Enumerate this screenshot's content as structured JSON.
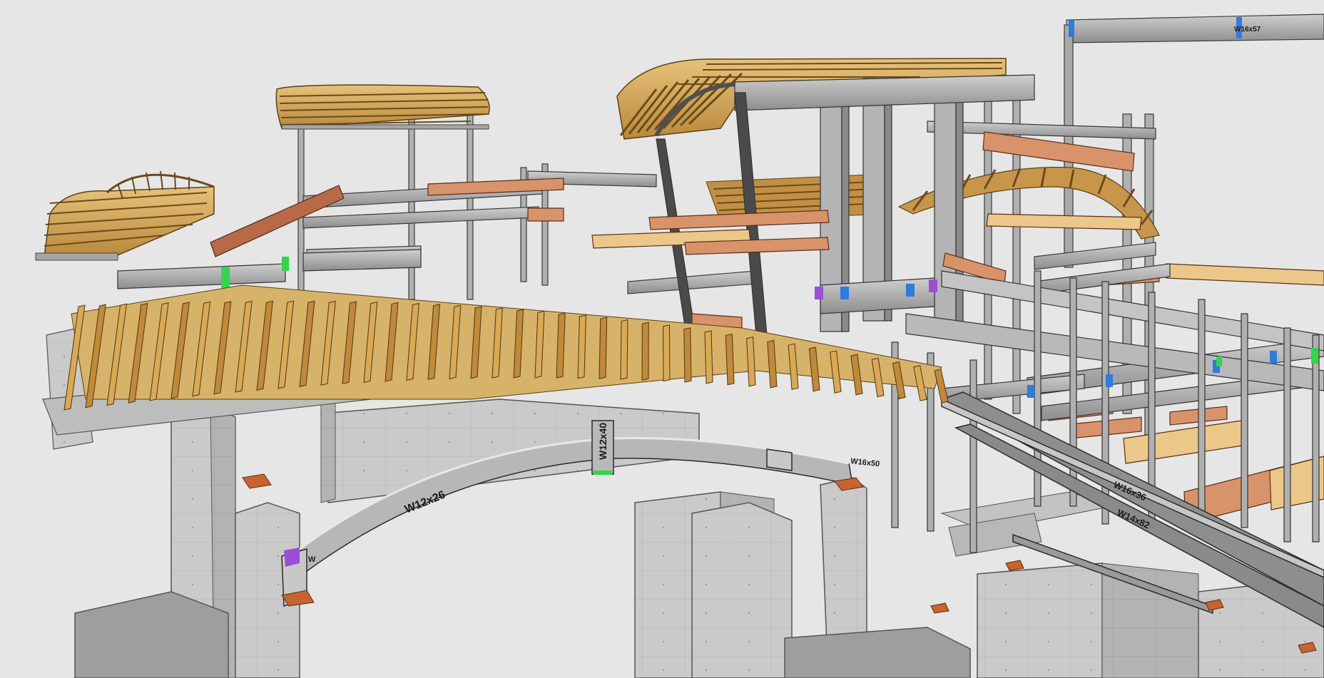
{
  "viewport": {
    "background": "#e6e6e6",
    "colors": {
      "concrete": "#c9c9c9",
      "concrete_dark": "#a8a8a8",
      "steel": "#a6a6a6",
      "steel_dark": "#6e6e6e",
      "steel_light": "#d2d2d2",
      "timber": "#c99a4a",
      "timber_light": "#e3c07a",
      "glulam": "#d8936b",
      "plate": "#c8642e",
      "conn_blue": "#2f7be0",
      "conn_purple": "#9b4fd6",
      "conn_green": "#31d64a"
    }
  },
  "labels": {
    "arch_beam": "W12x26",
    "post": "W12x40",
    "long_beam": "W14x82",
    "rail_beam": "W16x36",
    "short_beam": "W16x50",
    "side_beam": "W16x57",
    "small_w": "W"
  }
}
